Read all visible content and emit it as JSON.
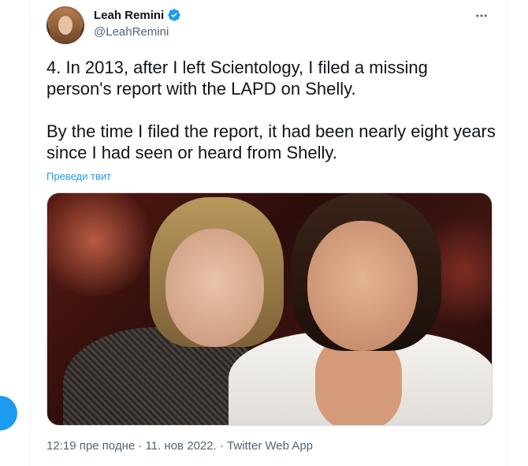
{
  "author": {
    "display_name": "Leah Remini",
    "handle": "@LeahRemini",
    "verified": true,
    "avatar_icon": "avatar-photo"
  },
  "tweet": {
    "paragraphs": [
      "4. In 2013, after I left Scientology, I filed a missing person's report with the LAPD on Shelly.",
      "By the time I filed the report, it had been nearly eight years since I had seen or heard from Shelly."
    ],
    "translate_label": "Преведи твит",
    "meta": "12:19 пре подне · 11. нов 2022. · Twitter Web App"
  },
  "icons": {
    "more": "more-dots-icon",
    "verified": "verified-badge-icon"
  },
  "colors": {
    "accent": "#1d9bf0",
    "text": "#0f1419",
    "secondary": "#536471"
  }
}
